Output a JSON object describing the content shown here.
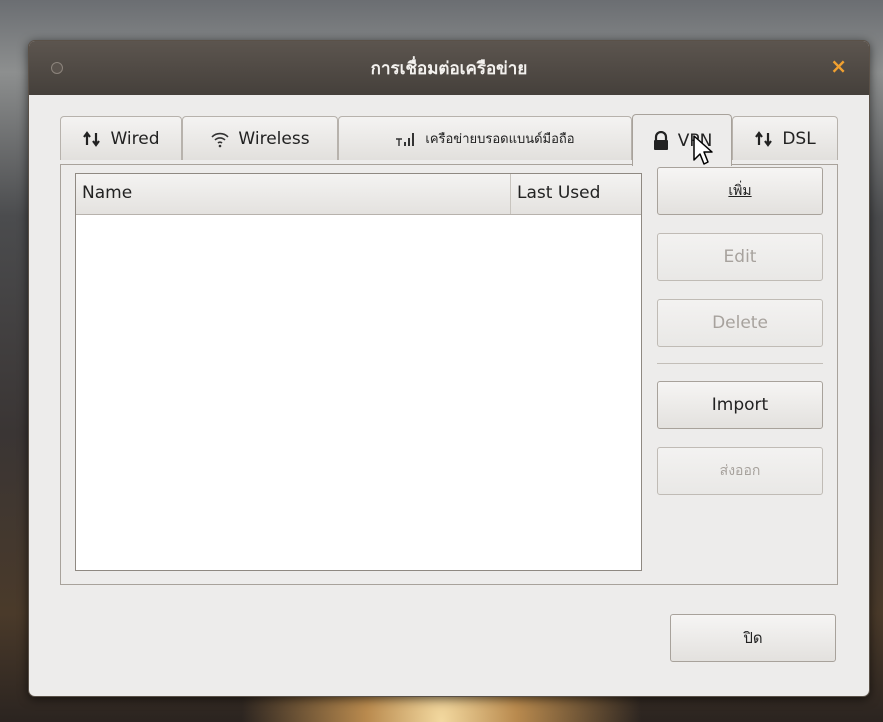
{
  "window": {
    "title": "การเชื่อมต่อเครือข่าย",
    "close_glyph": "×"
  },
  "tabs": [
    {
      "label": "Wired",
      "icon": "network-arrows-icon"
    },
    {
      "label": "Wireless",
      "icon": "wifi-icon"
    },
    {
      "label": "เครือข่ายบรอดแบนด์มือถือ",
      "icon": "signal-bars-icon"
    },
    {
      "label": "VPN",
      "icon": "lock-icon",
      "active": true
    },
    {
      "label": "DSL",
      "icon": "network-arrows-icon"
    }
  ],
  "list": {
    "columns": [
      "Name",
      "Last Used"
    ],
    "rows": []
  },
  "buttons": {
    "add": "เพิ่ม",
    "edit": "Edit",
    "delete": "Delete",
    "import": "Import",
    "export": "ส่งออก",
    "close": "ปิด"
  },
  "colors": {
    "accent_close": "#f0a030",
    "titlebar": "#4e4843"
  }
}
